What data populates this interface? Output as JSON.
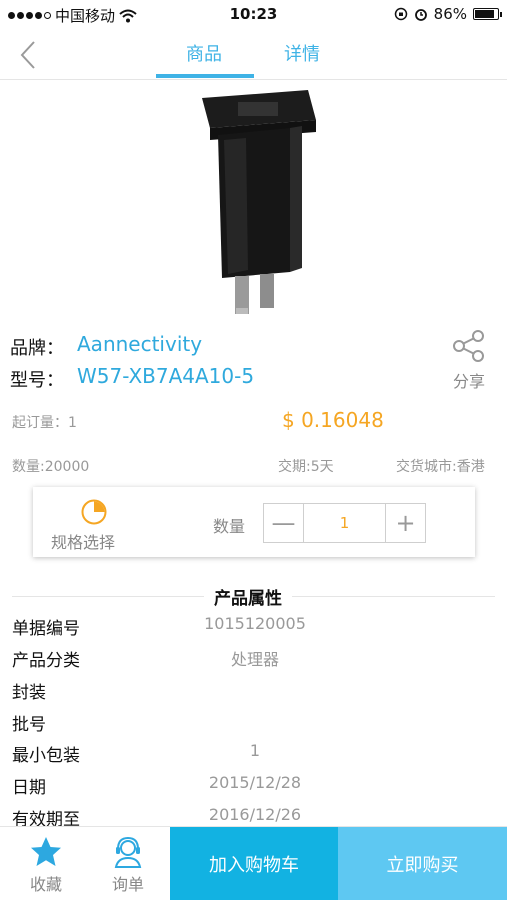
{
  "status_bar": {
    "carrier": "中国移动",
    "time": "10:23",
    "battery": "86%",
    "battery_level": 0.86,
    "icons": [
      "signal-icon",
      "wifi-icon",
      "orientation-lock-icon",
      "alarm-icon",
      "battery-icon"
    ]
  },
  "nav": {
    "tabs": [
      {
        "label": "商品",
        "active": true
      },
      {
        "label": "详情",
        "active": false
      }
    ],
    "back_icon": "chevron-left-icon",
    "accent": "#3fb3e6"
  },
  "product": {
    "brand_label": "品牌：",
    "brand": "Aannectivity",
    "model_label": "型号：",
    "model": "W57-XB7A4A10-5",
    "share_label": "分享",
    "moq_label": "起订量：1",
    "price": "$ 0.16048",
    "stock": "数量:20000",
    "lead_time": "交期:5天",
    "delivery_city": "交货城市:香港",
    "price_color": "#f5a623"
  },
  "spec": {
    "select_label": "规格选择",
    "qty_label": "数量",
    "qty_value": "1",
    "minus": "—",
    "plus": "+"
  },
  "attributes": {
    "title": "产品属性",
    "rows": [
      {
        "key": "单据编号",
        "value": "1015120005"
      },
      {
        "key": "产品分类",
        "value": "处理器"
      },
      {
        "key": "封装",
        "value": ""
      },
      {
        "key": "批号",
        "value": ""
      },
      {
        "key": "最小包装",
        "value": "1"
      },
      {
        "key": "日期",
        "value": "2015/12/28"
      },
      {
        "key": "有效期至",
        "value": "2016/12/26"
      }
    ]
  },
  "bottom_bar": {
    "favorite": "收藏",
    "inquiry": "询单",
    "add_to_cart": "加入购物车",
    "buy_now": "立即购买",
    "cart_color": "#12b2e2",
    "buy_color": "#5ec8f2"
  }
}
